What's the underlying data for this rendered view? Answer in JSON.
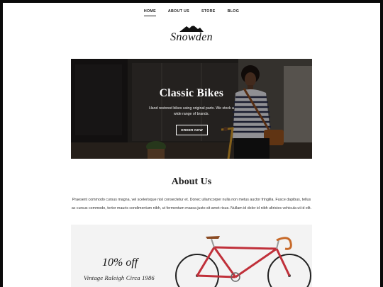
{
  "nav": {
    "items": [
      {
        "label": "HOME",
        "active": true
      },
      {
        "label": "ABOUT US",
        "active": false
      },
      {
        "label": "STORE",
        "active": false
      },
      {
        "label": "BLOG",
        "active": false
      }
    ]
  },
  "brand": {
    "name": "Snowden",
    "logo_icon": "mountain-icon"
  },
  "hero": {
    "title": "Classic Bikes",
    "subtitle": "Hand restored bikes using original parts. We stock a wide range of brands.",
    "button_label": "ORDER NOW"
  },
  "about": {
    "title": "About Us",
    "body": "Praesent commodo cursus magna, vel scelerisque nisl consectetur et. Donec ullamcorper nulla non metus auctor fringilla. Fusce dapibus, tellus ac cursus commodo, tortor mauris condimentum nibh, ut fermentum massa justo sit amet risus. Nullam id dolor id nibh ultricies vehicula ut id elit."
  },
  "promo": {
    "discount": "10% off",
    "product": "Vintage Raleigh Circa 1986"
  },
  "colors": {
    "background": "#ffffff",
    "text": "#222222",
    "hero_overlay": "#000000",
    "bike_frame": "#c0303a"
  }
}
